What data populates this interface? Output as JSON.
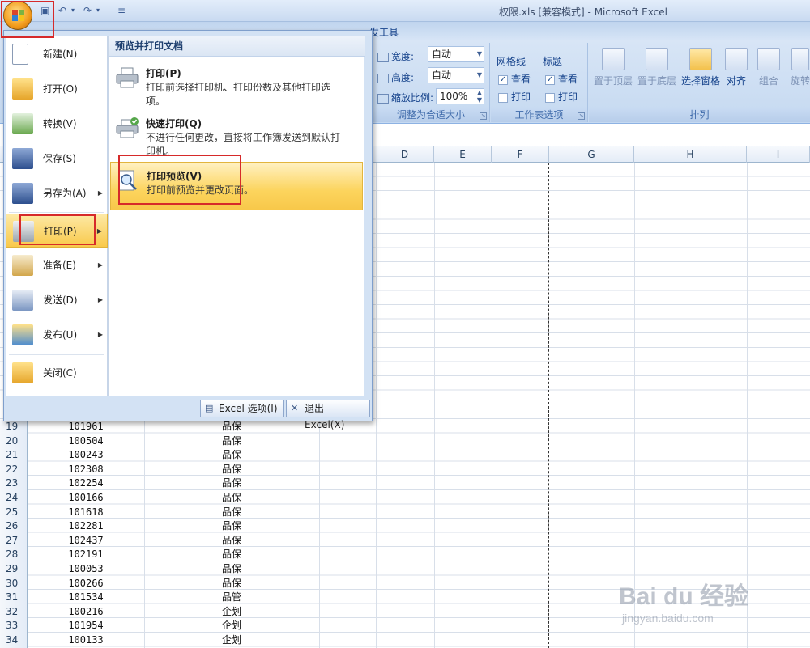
{
  "window": {
    "title": "权限.xls  [兼容模式] - Microsoft Excel"
  },
  "ribbon": {
    "partial_tab": "发工具",
    "scale_group": {
      "width_label": "宽度:",
      "width_value": "自动",
      "height_label": "高度:",
      "height_value": "自动",
      "zoom_label": "缩放比例:",
      "zoom_value": "100%",
      "group_label": "调整为合适大小"
    },
    "sheet_options": {
      "gridlines_header": "网格线",
      "headings_header": "标题",
      "view_label": "查看",
      "print_label": "打印",
      "gridlines_view_checked": true,
      "gridlines_print_checked": false,
      "headings_view_checked": true,
      "headings_print_checked": false,
      "group_label": "工作表选项"
    },
    "arrange": {
      "bring_front": "置于顶层",
      "send_back": "置于底层",
      "selection_pane": "选择窗格",
      "align": "对齐",
      "group": "组合",
      "rotate": "旋转",
      "group_label": "排列"
    }
  },
  "office_menu": {
    "items": [
      {
        "label": "新建(N)",
        "submenu": false
      },
      {
        "label": "打开(O)",
        "submenu": false
      },
      {
        "label": "转换(V)",
        "submenu": false
      },
      {
        "label": "保存(S)",
        "submenu": false
      },
      {
        "label": "另存为(A)",
        "submenu": true
      },
      {
        "label": "打印(P)",
        "submenu": true,
        "active": true
      },
      {
        "label": "准备(E)",
        "submenu": true
      },
      {
        "label": "发送(D)",
        "submenu": true
      },
      {
        "label": "发布(U)",
        "submenu": true
      },
      {
        "label": "关闭(C)",
        "submenu": false
      }
    ],
    "submenu_title": "预览并打印文档",
    "submenu_items": [
      {
        "title": "打印(P)",
        "desc": "打印前选择打印机、打印份数及其他打印选项。"
      },
      {
        "title": "快速打印(Q)",
        "desc": "不进行任何更改，直接将工作簿发送到默认打印机。"
      },
      {
        "title": "打印预览(V)",
        "desc": "打印前预览并更改页面。",
        "active": true
      }
    ],
    "excel_options": "Excel 选项(I)",
    "exit_excel": "退出 Excel(X)"
  },
  "sheet": {
    "columns": [
      "D",
      "E",
      "F",
      "G",
      "H",
      "I"
    ],
    "rows": [
      {
        "num": "19",
        "id": "101961",
        "dept": "品保"
      },
      {
        "num": "20",
        "id": "100504",
        "dept": "品保"
      },
      {
        "num": "21",
        "id": "100243",
        "dept": "品保"
      },
      {
        "num": "22",
        "id": "102308",
        "dept": "品保"
      },
      {
        "num": "23",
        "id": "102254",
        "dept": "品保"
      },
      {
        "num": "24",
        "id": "100166",
        "dept": "品保"
      },
      {
        "num": "25",
        "id": "101618",
        "dept": "品保"
      },
      {
        "num": "26",
        "id": "102281",
        "dept": "品保"
      },
      {
        "num": "27",
        "id": "102437",
        "dept": "品保"
      },
      {
        "num": "28",
        "id": "102191",
        "dept": "品保"
      },
      {
        "num": "29",
        "id": "100053",
        "dept": "品保"
      },
      {
        "num": "30",
        "id": "100266",
        "dept": "品保"
      },
      {
        "num": "31",
        "id": "101534",
        "dept": "品管"
      },
      {
        "num": "32",
        "id": "100216",
        "dept": "企划"
      },
      {
        "num": "33",
        "id": "101954",
        "dept": "企划"
      },
      {
        "num": "34",
        "id": "100133",
        "dept": "企划"
      }
    ]
  },
  "watermark": {
    "logo": "Bai du 经验",
    "url": "jingyan.baidu.com"
  }
}
